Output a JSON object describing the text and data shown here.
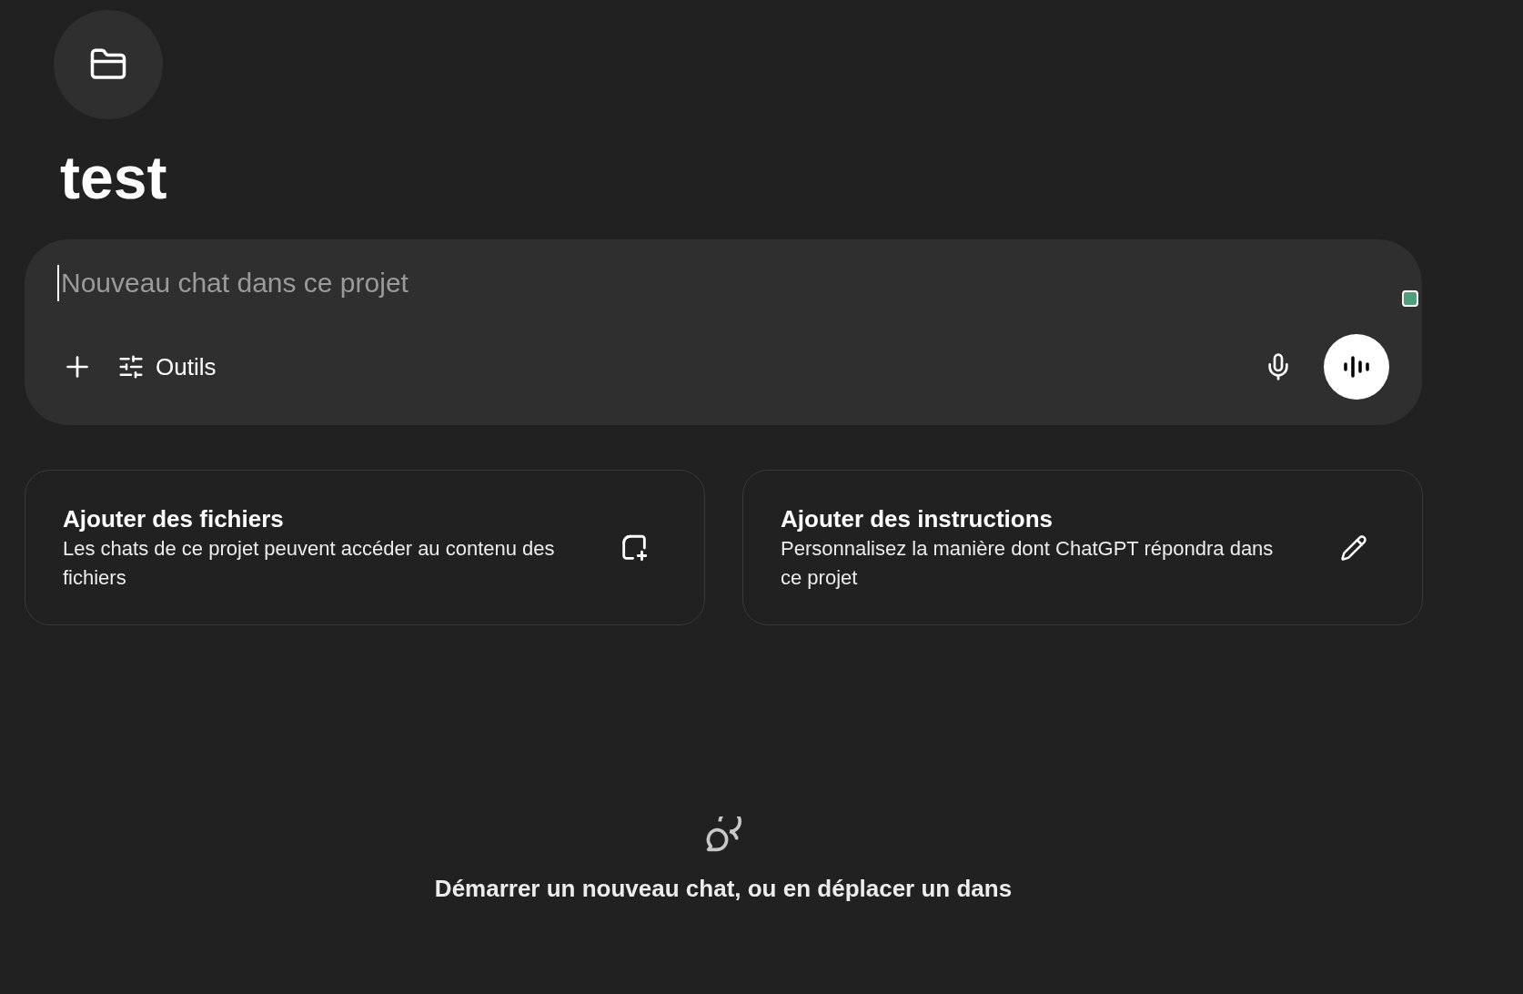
{
  "project": {
    "title": "test"
  },
  "composer": {
    "placeholder": "Nouveau chat dans ce projet",
    "tools_label": "Outils"
  },
  "cards": [
    {
      "kind": "files",
      "title": "Ajouter des fichiers",
      "description": "Les chats de ce projet peuvent accéder au contenu des fichiers"
    },
    {
      "kind": "instructions",
      "title": "Ajouter des instructions",
      "description": "Personnalisez la manière dont ChatGPT répondra dans ce projet"
    }
  ],
  "empty_state": {
    "message": "Démarrer un nouveau chat, ou en déplacer un dans"
  }
}
